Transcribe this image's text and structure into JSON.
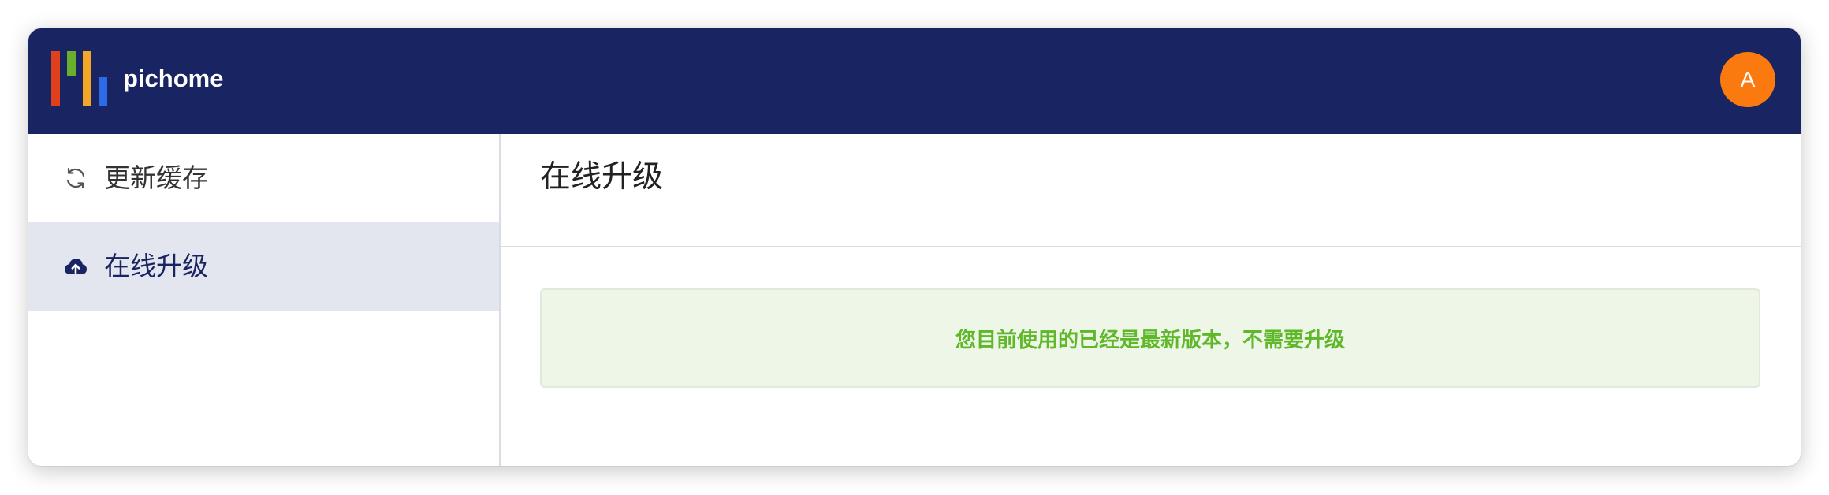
{
  "header": {
    "brand": "pichome",
    "logo_icon": "pichome-logo",
    "avatar_initial": "A"
  },
  "sidebar": {
    "items": [
      {
        "label": "更新缓存",
        "icon": "refresh-icon",
        "active": false
      },
      {
        "label": "在线升级",
        "icon": "cloud-upload-icon",
        "active": true
      }
    ]
  },
  "main": {
    "title": "在线升级",
    "alert": {
      "type": "success",
      "text": "您目前使用的已经是最新版本，不需要升级"
    }
  },
  "colors": {
    "header_bg": "#192462",
    "avatar_bg": "#fa7a10",
    "active_item_bg": "#e3e6ee",
    "alert_bg": "#eef6e7",
    "alert_text": "#5fb829",
    "logo_bars": [
      "#e0401b",
      "#6ab02c",
      "#f2a826",
      "#2b6be8"
    ]
  }
}
